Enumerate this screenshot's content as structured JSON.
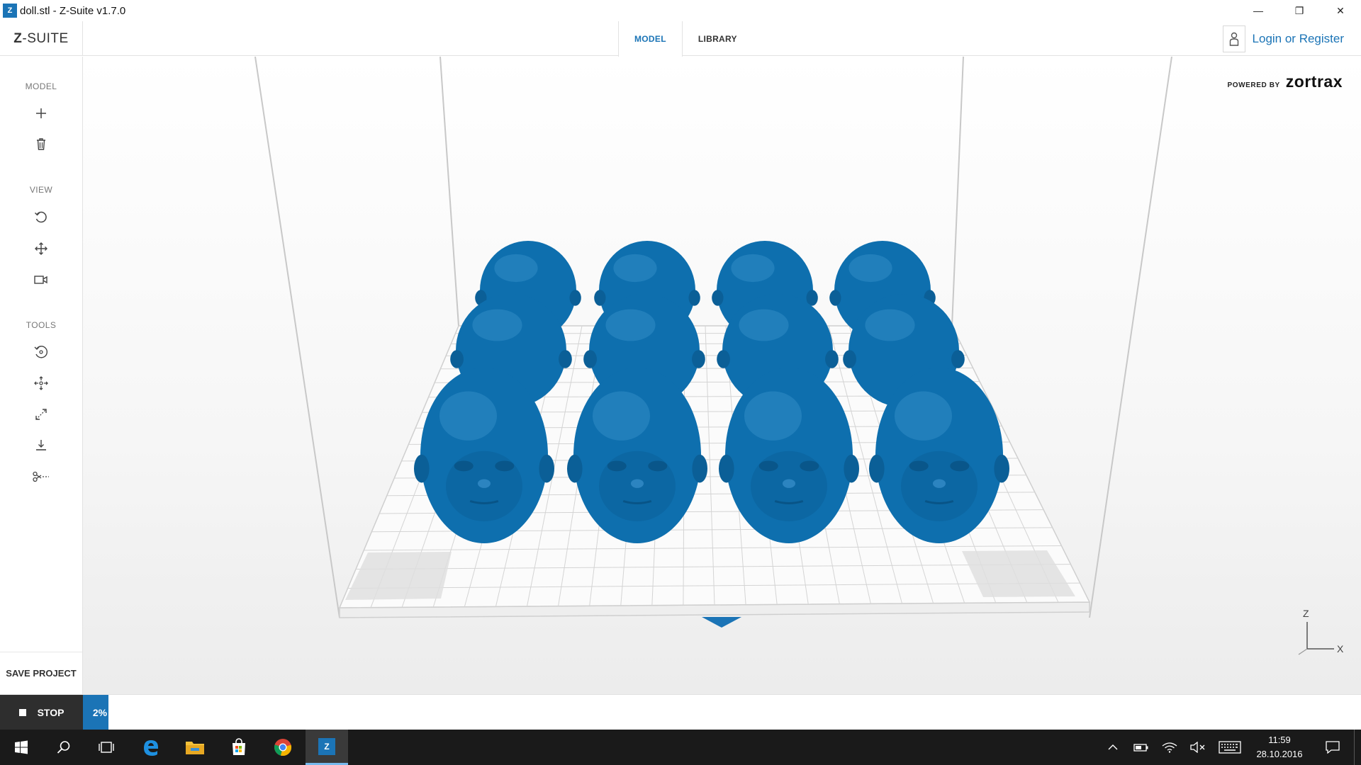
{
  "window": {
    "title": "doll.stl - Z-Suite v1.7.0",
    "app_icon_letter": "Z",
    "minimize_glyph": "—",
    "restore_glyph": "❐",
    "close_glyph": "✕"
  },
  "header": {
    "logo_prefix": "Z",
    "logo_suffix": "-SUITE",
    "tabs": [
      {
        "label": "MODEL",
        "active": true
      },
      {
        "label": "LIBRARY",
        "active": false
      }
    ],
    "login_label": "Login or Register"
  },
  "sidebar": {
    "sections": [
      {
        "label": "MODEL",
        "tools": [
          "plus-icon",
          "trash-icon"
        ]
      },
      {
        "label": "VIEW",
        "tools": [
          "rotate-view-icon",
          "pan-icon",
          "camera-icon"
        ]
      },
      {
        "label": "TOOLS",
        "tools": [
          "rotate-model-icon",
          "move-model-icon",
          "scale-icon",
          "place-on-bed-icon",
          "cut-icon"
        ]
      }
    ],
    "save_label": "SAVE PROJECT"
  },
  "viewport": {
    "powered_label": "POWERED BY",
    "powered_brand": "zortrax",
    "model_color": "#0e6fae",
    "model_count": 12,
    "axis_z": "Z",
    "axis_x": "X"
  },
  "progress": {
    "stop_label": "STOP",
    "percent_label": "2%",
    "percent": 2
  },
  "taskbar": {
    "time": "11:59",
    "date": "28.10.2016",
    "zsuite_letter": "Z"
  },
  "colors": {
    "accent": "#1b74b6",
    "taskbar": "#1a1a1a"
  }
}
